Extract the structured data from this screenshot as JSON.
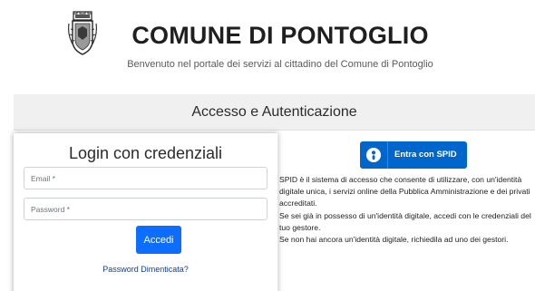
{
  "header": {
    "title": "COMUNE DI PONTOGLIO",
    "subtitle": "Benvenuto nel portale dei servizi al cittadino del Comune di Pontoglio"
  },
  "auth": {
    "title": "Accesso e Autenticazione"
  },
  "login": {
    "title": "Login con credenziali",
    "email_placeholder": "Email *",
    "password_placeholder": "Password *",
    "submit_label": "Accedi",
    "forgot_label": "Password Dimenticata?"
  },
  "spid": {
    "button_label": "Entra con SPID",
    "icon": "spid-person-icon",
    "paragraphs": [
      "SPID è il sistema di accesso che consente di utilizzare, con un'identità digitale unica, i servizi online della Pubblica Amministrazione e dei privati accreditati.",
      "Se sei già in possesso di un'identità digitale, accedi con le credenziali del tuo gestore.",
      "Se non hai ancora un'identità digitale, richiedila ad uno dei gestori."
    ]
  },
  "colors": {
    "primary": "#0d6efd",
    "spid_blue": "#0066cc",
    "band_bg": "#f0f0f0",
    "link": "#0d3f9e"
  }
}
